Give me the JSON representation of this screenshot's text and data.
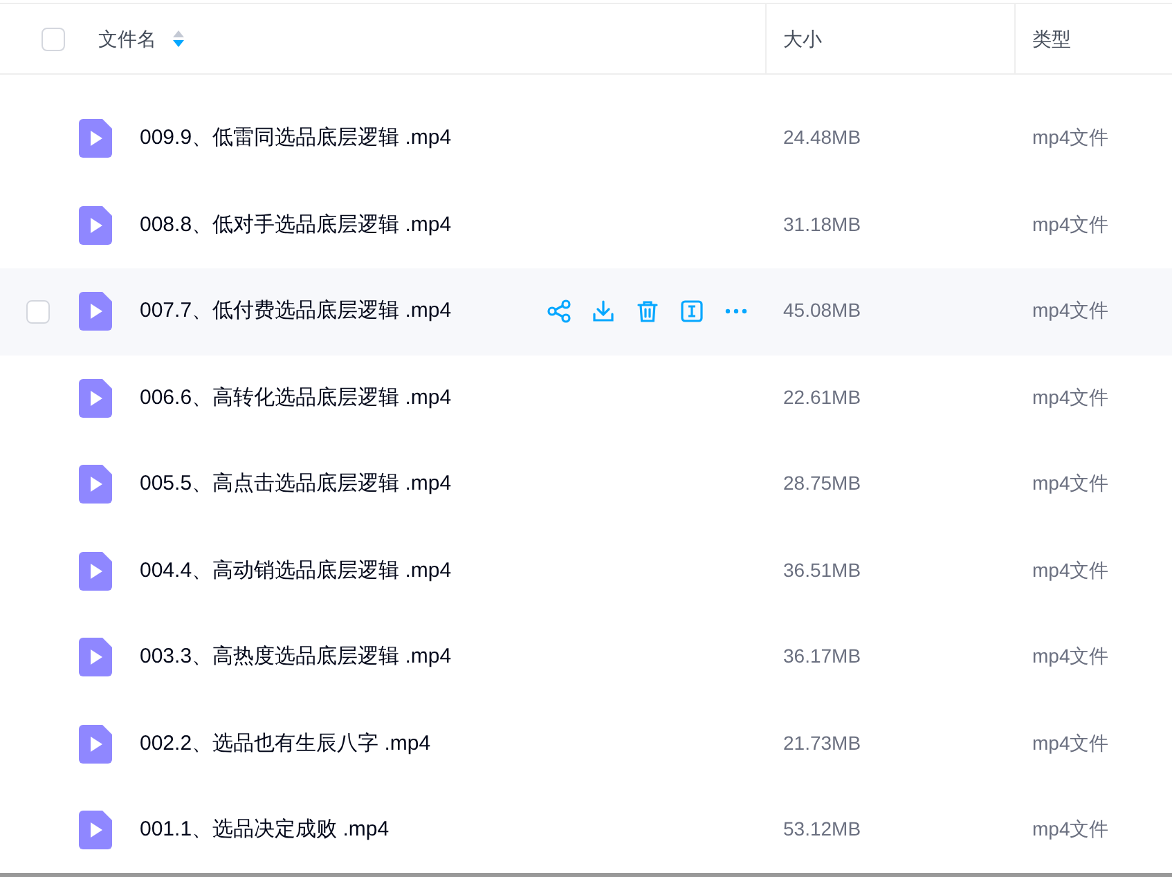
{
  "header": {
    "select_all": {
      "checked": false
    },
    "columns": [
      {
        "label": "文件名",
        "descending": true
      },
      {
        "label": "大小"
      },
      {
        "label": "类型"
      }
    ]
  },
  "rows": [
    {
      "name": "009.9、低雷同选品底层逻辑 .mp4",
      "size": "24.48MB",
      "type": "mp4文件",
      "hovered": false
    },
    {
      "name": "008.8、低对手选品底层逻辑 .mp4",
      "size": "31.18MB",
      "type": "mp4文件",
      "hovered": false
    },
    {
      "name": "007.7、低付费选品底层逻辑 .mp4",
      "size": "45.08MB",
      "type": "mp4文件",
      "hovered": true
    },
    {
      "name": "006.6、高转化选品底层逻辑 .mp4",
      "size": "22.61MB",
      "type": "mp4文件",
      "hovered": false
    },
    {
      "name": "005.5、高点击选品底层逻辑 .mp4",
      "size": "28.75MB",
      "type": "mp4文件",
      "hovered": false
    },
    {
      "name": "004.4、高动销选品底层逻辑 .mp4",
      "size": "36.51MB",
      "type": "mp4文件",
      "hovered": false
    },
    {
      "name": "003.3、高热度选品底层逻辑 .mp4",
      "size": "36.17MB",
      "type": "mp4文件",
      "hovered": false
    },
    {
      "name": "002.2、选品也有生辰八字 .mp4",
      "size": "21.73MB",
      "type": "mp4文件",
      "hovered": false
    },
    {
      "name": "001.1、选品决定成败 .mp4",
      "size": "53.12MB",
      "type": "mp4文件",
      "hovered": false
    }
  ]
}
